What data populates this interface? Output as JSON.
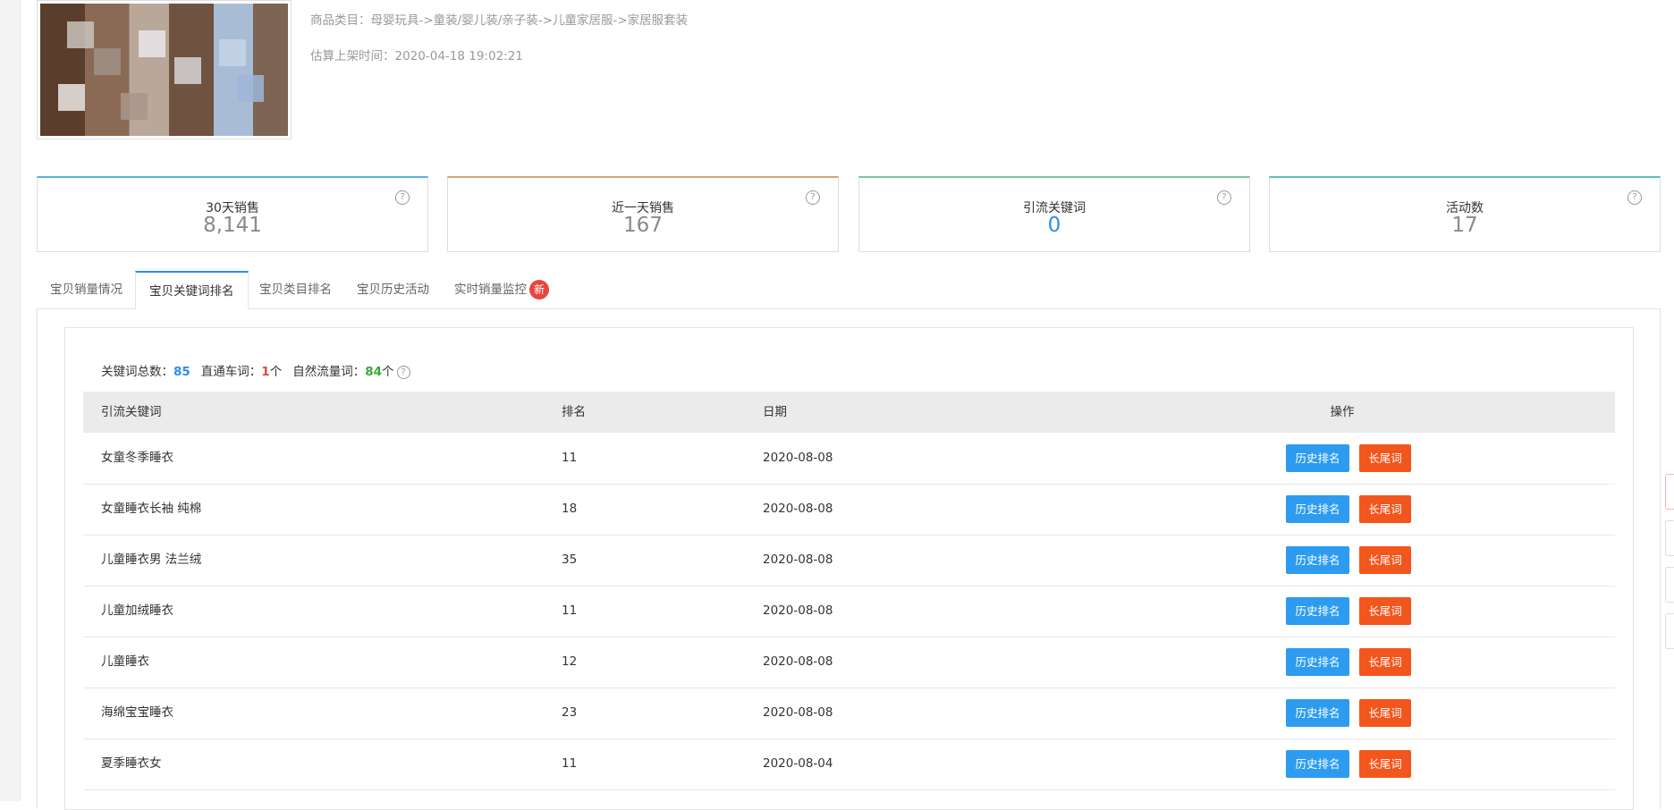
{
  "product": {
    "category_label": "商品类目：",
    "category_path": "母婴玩具->童装/婴儿装/亲子装->儿童家居服->家居服套装",
    "listing_time_label": "估算上架时间：",
    "listing_time": "2020-04-18 19:02:21"
  },
  "stats": [
    {
      "label": "30天销售",
      "value": "8,141",
      "accent": "#58b4e6"
    },
    {
      "label": "近一天销售",
      "value": "167",
      "accent": "#e0a070"
    },
    {
      "label": "引流关键词",
      "value": "0",
      "accent": "#7cc4a0",
      "value_color": "#2d8cf0"
    },
    {
      "label": "活动数",
      "value": "17",
      "accent": "#5bc0c0"
    }
  ],
  "help_glyph": "?",
  "tabs": [
    {
      "label": "宝贝销量情况"
    },
    {
      "label": "宝贝关键词排名",
      "active": true
    },
    {
      "label": "宝贝类目排名"
    },
    {
      "label": "宝贝历史活动"
    },
    {
      "label": "实时销量监控",
      "badge": "新"
    }
  ],
  "summary": {
    "total_label": "关键词总数：",
    "total": "85",
    "ztc_label": "直通车词：",
    "ztc": "1",
    "ztc_unit": "个",
    "natural_label": "自然流量词：",
    "natural": "84",
    "natural_unit": "个"
  },
  "table": {
    "headers": [
      "引流关键词",
      "排名",
      "日期",
      "操作"
    ],
    "history_btn": "历史排名",
    "longtail_btn": "长尾词",
    "rows": [
      {
        "keyword": "女童冬季睡衣",
        "rank": "11",
        "date": "2020-08-08"
      },
      {
        "keyword": "女童睡衣长袖 纯棉",
        "rank": "18",
        "date": "2020-08-08"
      },
      {
        "keyword": "儿童睡衣男 法兰绒",
        "rank": "35",
        "date": "2020-08-08"
      },
      {
        "keyword": "儿童加绒睡衣",
        "rank": "11",
        "date": "2020-08-08"
      },
      {
        "keyword": "儿童睡衣",
        "rank": "12",
        "date": "2020-08-08"
      },
      {
        "keyword": "海绵宝宝睡衣",
        "rank": "23",
        "date": "2020-08-08"
      },
      {
        "keyword": "夏季睡衣女",
        "rank": "11",
        "date": "2020-08-04"
      }
    ]
  }
}
